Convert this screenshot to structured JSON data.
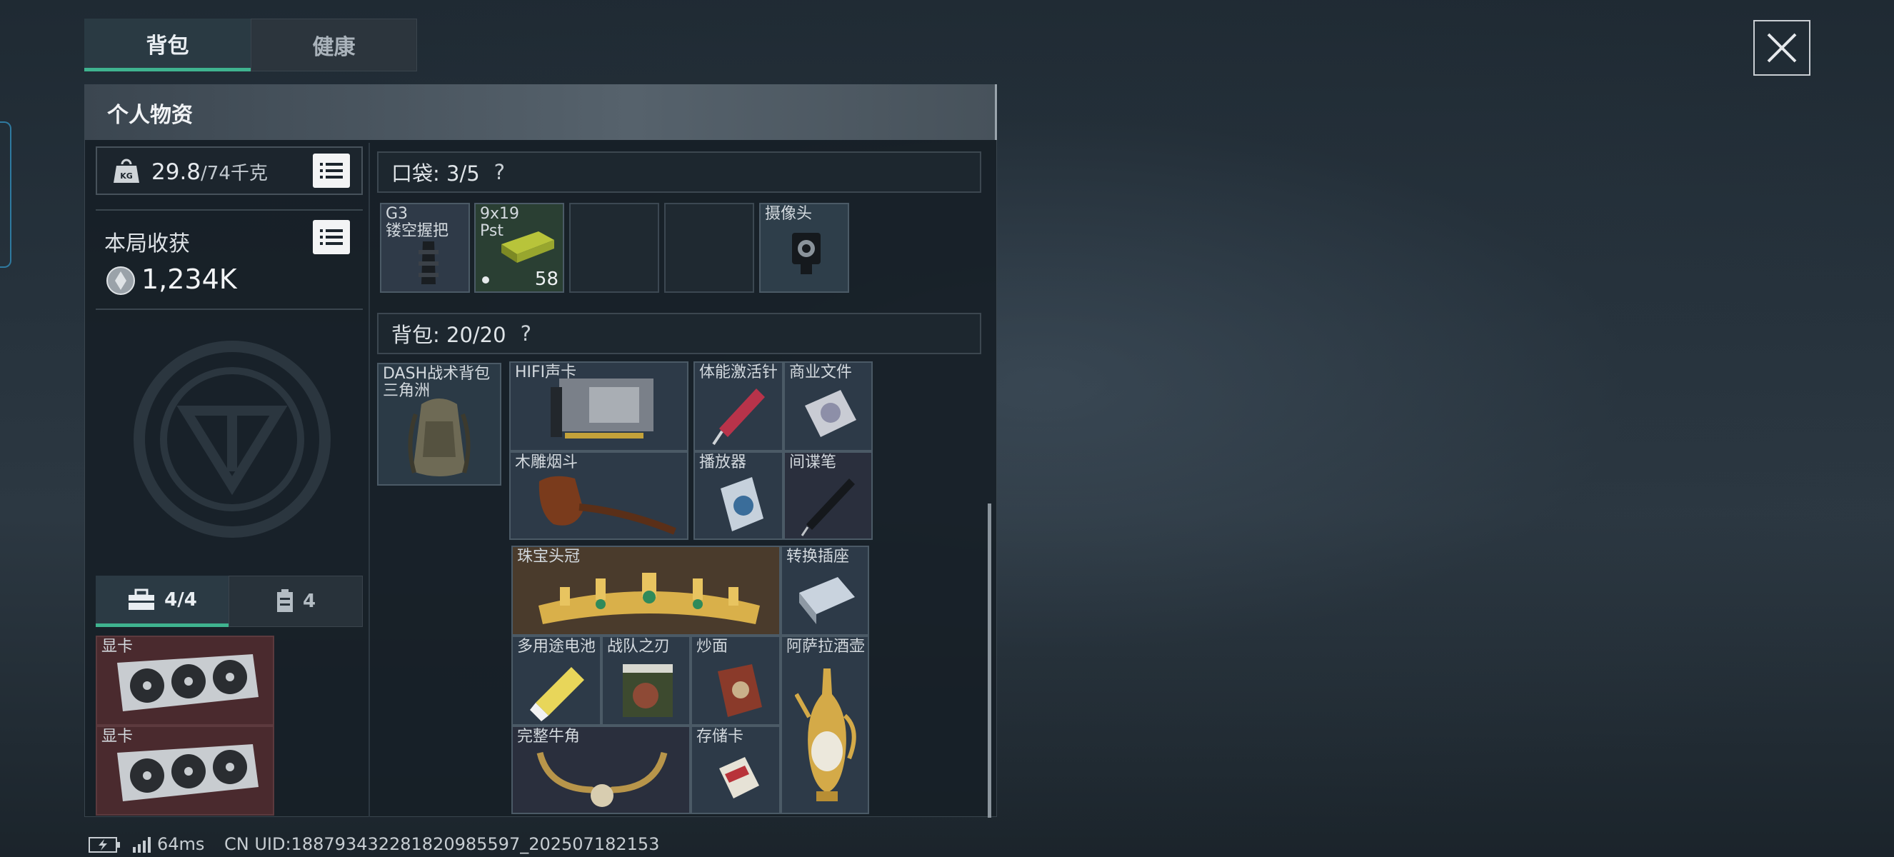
{
  "tabs": {
    "backpack": "背包",
    "health": "健康"
  },
  "panel": {
    "title": "个人物资"
  },
  "weight": {
    "current": "29.8",
    "max": "/74千克"
  },
  "earnings": {
    "label": "本局收获",
    "value": "1,234K"
  },
  "pocket": {
    "title": "口袋: 3/5",
    "help": "?"
  },
  "pocket_items": [
    {
      "name": "G3",
      "sub": "镂空握把"
    },
    {
      "name": "9x19",
      "sub": "Pst",
      "count": "58"
    },
    {
      "name": ""
    },
    {
      "name": ""
    },
    {
      "name": "摄像头"
    }
  ],
  "backpack": {
    "title": "背包: 20/20",
    "help": "?"
  },
  "backpack_slot": {
    "name": "DASH战术背包",
    "sub": "三角洲"
  },
  "grid_a": {
    "hifi": "HIFI声卡",
    "stim": "体能激活针",
    "docs": "商业文件",
    "pipe": "木雕烟斗",
    "player": "播放器",
    "spypen": "间谍笔"
  },
  "grid_b": {
    "crown": "珠宝头冠",
    "adapter": "转换插座",
    "battery": "多用途电池",
    "blade": "战队之刃",
    "noodle": "炒面",
    "ewer": "阿萨拉酒壶",
    "horn": "完整牛角",
    "card": "存储卡"
  },
  "lower_tabs": {
    "case": "4/4",
    "box": "4"
  },
  "case_items": [
    {
      "name": "显卡"
    },
    {
      "name": "显卡"
    }
  ],
  "status": {
    "ping": "64ms",
    "uid": "CN UID:1887934322818209855​97_202507182153"
  },
  "colors": {
    "accent": "#3fb38f",
    "case_bg": "#4a2a2e",
    "crown_bg": "#4a3b2c"
  }
}
